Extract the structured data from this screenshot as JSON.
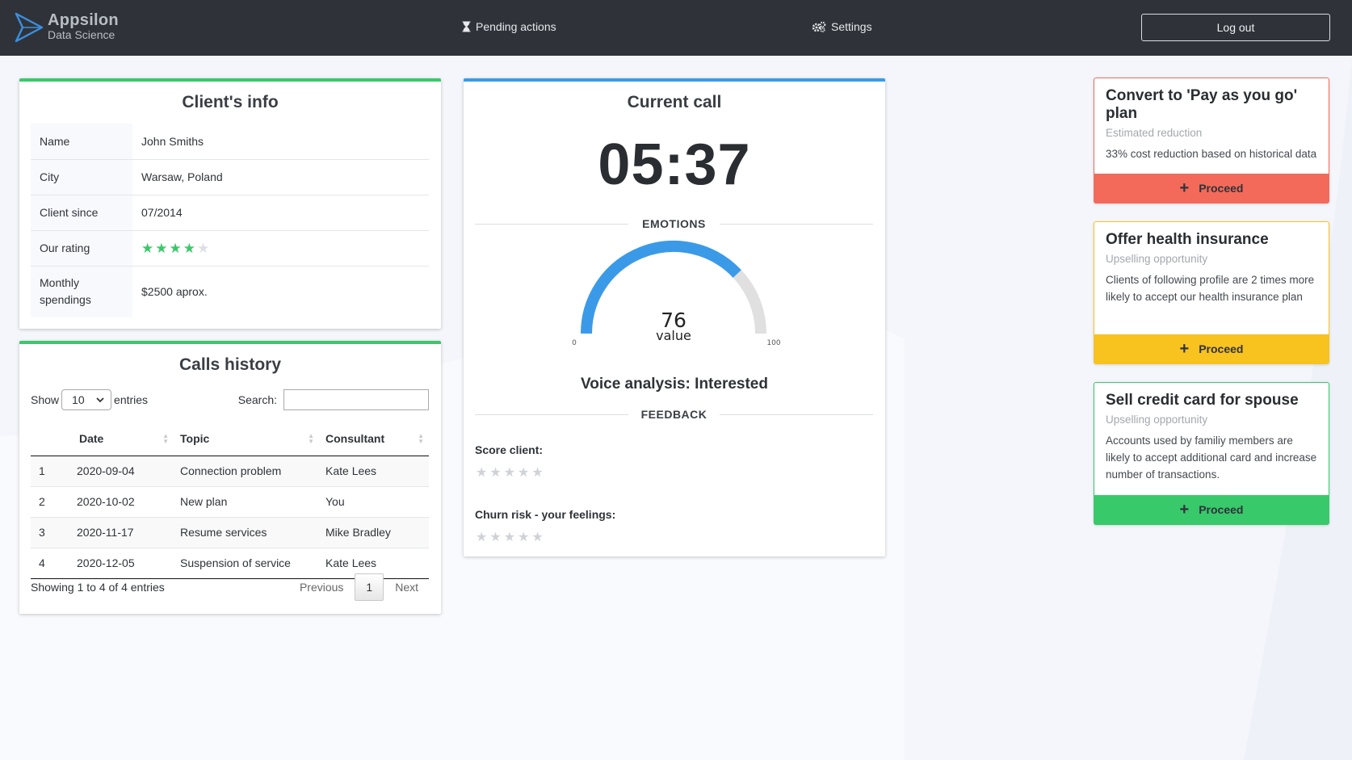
{
  "brand": {
    "name": "Appsilon",
    "sub": "Data Science"
  },
  "nav": {
    "pending": "Pending actions",
    "settings": "Settings",
    "logout": "Log out"
  },
  "client": {
    "title": "Client's info",
    "rows": [
      {
        "key": "Name",
        "value": "John Smiths"
      },
      {
        "key": "City",
        "value": "Warsaw, Poland"
      },
      {
        "key": "Client since",
        "value": "07/2014"
      },
      {
        "key": "Our rating",
        "rating": 4,
        "max": 5
      },
      {
        "key": "Monthly spendings",
        "value": "$2500 aprox."
      }
    ]
  },
  "calls": {
    "title": "Calls history",
    "show_label": "Show",
    "entries_label": "entries",
    "page_size": "10",
    "search_label": "Search:",
    "columns": [
      "Date",
      "Topic",
      "Consultant"
    ],
    "rows": [
      {
        "n": "1",
        "date": "2020-09-04",
        "topic": "Connection problem",
        "consultant": "Kate Lees"
      },
      {
        "n": "2",
        "date": "2020-10-02",
        "topic": "New plan",
        "consultant": "You"
      },
      {
        "n": "3",
        "date": "2020-11-17",
        "topic": "Resume services",
        "consultant": "Mike Bradley"
      },
      {
        "n": "4",
        "date": "2020-12-05",
        "topic": "Suspension of service",
        "consultant": "Kate Lees"
      }
    ],
    "info": "Showing 1 to 4 of 4 entries",
    "prev": "Previous",
    "page": "1",
    "next": "Next"
  },
  "call": {
    "title": "Current call",
    "timer": "05:37",
    "emotions_label": "EMOTIONS",
    "gauge": {
      "value": 76,
      "min": 0,
      "max": 100,
      "value_label": "value",
      "min_label": "0",
      "max_label": "100",
      "fill_color": "#3b9ae8",
      "track_color": "#e0e0e0"
    },
    "voice": "Voice analysis: Interested",
    "feedback_label": "FEEDBACK",
    "score_label": "Score client:",
    "churn_label": "Churn risk - your feelings:"
  },
  "offers": [
    {
      "title": "Convert to 'Pay as you go' plan",
      "sub": "Estimated reduction",
      "desc": "33% cost reduction based on historical data",
      "button": "Proceed",
      "color": "#f36a5b"
    },
    {
      "title": "Offer health insurance",
      "sub": "Upselling opportunity",
      "desc": "Clients of following profile are 2 times more likely to accept our health insurance plan",
      "button": "Proceed",
      "color": "#f8c21f"
    },
    {
      "title": "Sell credit card for spouse",
      "sub": "Upselling opportunity",
      "desc": "Accounts used by familiy members are likely to accept additional card and increase number of transactions.",
      "button": "Proceed",
      "color": "#38c96b"
    }
  ]
}
